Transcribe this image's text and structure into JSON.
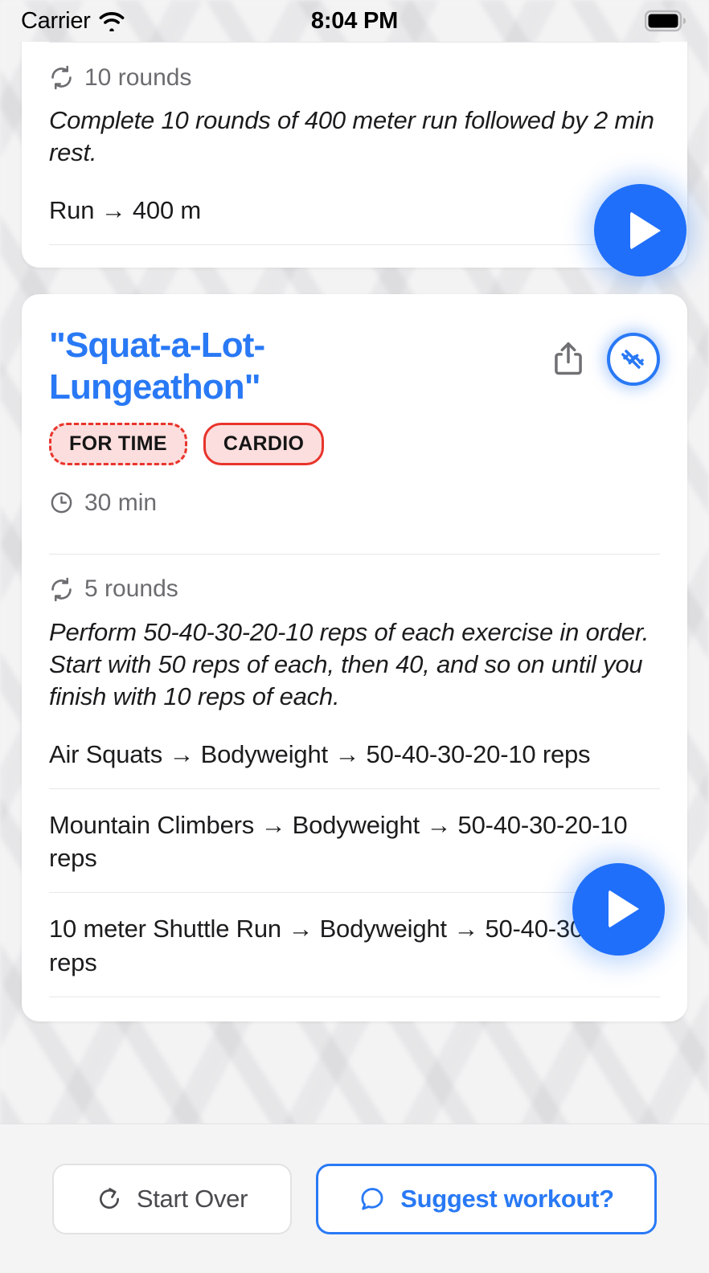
{
  "status_bar": {
    "carrier": "Carrier",
    "wifi_icon": "wifi-icon",
    "time": "8:04 PM",
    "battery_icon": "battery-full-icon"
  },
  "cards": [
    {
      "partial": true,
      "rounds_icon": "repeat-icon",
      "rounds": "10 rounds",
      "description": "Complete 10 rounds of 400 meter run followed by 2 min rest.",
      "exercises": [
        "Run → 400 m"
      ],
      "play_icon": "play-icon"
    },
    {
      "partial": false,
      "title": "\"Squat-a-Lot-Lungeathon\"",
      "share_icon": "share-icon",
      "dumbbell_icon": "dumbbell-icon",
      "badges": [
        {
          "label": "FOR TIME",
          "style": "dashed"
        },
        {
          "label": "CARDIO",
          "style": "solid"
        }
      ],
      "duration_icon": "clock-icon",
      "duration": "30 min",
      "rounds_icon": "repeat-icon",
      "rounds": "5 rounds",
      "description": "Perform 50-40-30-20-10 reps of each exercise in order. Start with 50 reps of each, then 40, and so on until you finish with 10 reps of each.",
      "exercises": [
        "Air Squats → Bodyweight → 50-40-30-20-10 reps",
        "Mountain Climbers → Bodyweight → 50-40-30-20-10 reps",
        "10 meter Shuttle Run → Bodyweight → 50-40-30-20-10 reps"
      ],
      "play_icon": "play-icon"
    }
  ],
  "bottom_bar": {
    "start_over": {
      "label": "Start Over",
      "icon": "rotate-ccw-icon"
    },
    "suggest": {
      "label": "Suggest workout?",
      "icon": "message-circle-icon"
    }
  },
  "colors": {
    "accent_blue": "#2979f5",
    "play_blue": "#1f6ffa",
    "badge_red": "#e8342c",
    "badge_bg": "#fbdedd",
    "page_bg": "#f2f2f3",
    "card_bg": "#ffffff",
    "muted_text": "#6c6c70",
    "body_text": "#1c1c1e"
  }
}
